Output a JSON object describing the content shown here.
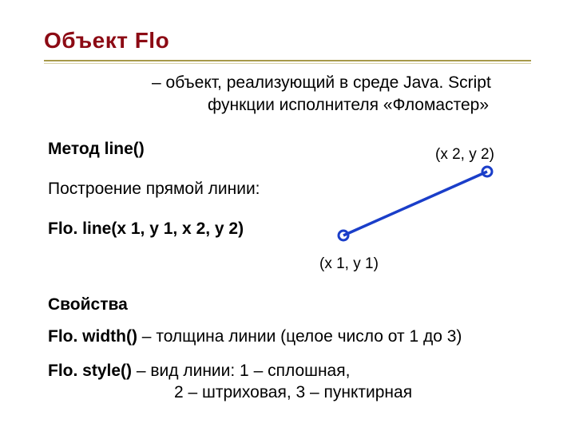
{
  "title": "Объект  Flo",
  "intro_line1": "– объект, реализующий в среде Java. Script",
  "intro_line2": "функции исполнителя «Фломастер»",
  "method_heading": "Метод  line()",
  "construction": "Построение прямой линии:",
  "call_signature": "Flo. line(x 1, y 1, x 2, y 2)",
  "coord1": "(x 1, y 1)",
  "coord2": "(x 2, y 2)",
  "properties_heading": "Cвойства",
  "width_prop": {
    "name": "Flo. width()",
    "desc": " – толщина линии (целое число от 1 до 3)"
  },
  "style_prop": {
    "name": "Flo. style()",
    "desc1": "  – вид линии:  1 – сплошная,",
    "desc2": "2 – штриховая,   3 – пунктирная"
  }
}
